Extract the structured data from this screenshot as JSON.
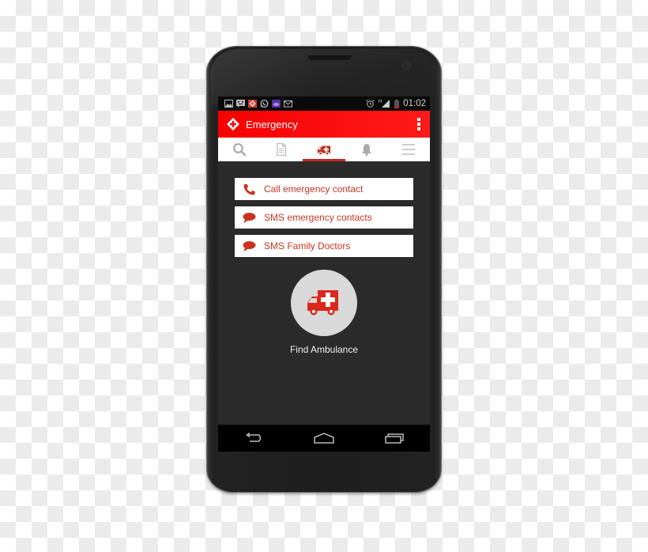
{
  "colors": {
    "brand_red": "#ff0000",
    "accent_red": "#c93421",
    "screen_bg": "#2b2b2b",
    "fab_bg": "#d9d9d9"
  },
  "statusbar": {
    "notification_icons": [
      "image-icon",
      "message-icon",
      "app-emergency-icon",
      "whatsapp-icon",
      "cloud-app-icon",
      "gmail-icon"
    ],
    "system_icons": [
      "alarm-icon",
      "signal-icon",
      "battery-icon"
    ],
    "network_label": "H",
    "time": "01:02"
  },
  "appbar": {
    "title": "Emergency",
    "logo_icon": "emergency-diamond-icon",
    "menu_icon": "overflow-menu-icon"
  },
  "tabs": [
    {
      "icon": "search-icon",
      "active": false
    },
    {
      "icon": "document-icon",
      "active": false
    },
    {
      "icon": "ambulance-icon",
      "active": true
    },
    {
      "icon": "bell-icon",
      "active": false
    },
    {
      "icon": "menu-icon",
      "active": false
    }
  ],
  "actions": [
    {
      "label": "Call emergency contact",
      "icon": "phone-icon"
    },
    {
      "label": "SMS emergency contacts",
      "icon": "chat-bubble-icon"
    },
    {
      "label": "SMS Family Doctors",
      "icon": "chat-bubble-icon"
    }
  ],
  "find_ambulance": {
    "label": "Find Ambulance",
    "icon": "ambulance-icon"
  },
  "navbar": {
    "buttons": [
      "back-icon",
      "home-icon",
      "recent-apps-icon"
    ]
  }
}
